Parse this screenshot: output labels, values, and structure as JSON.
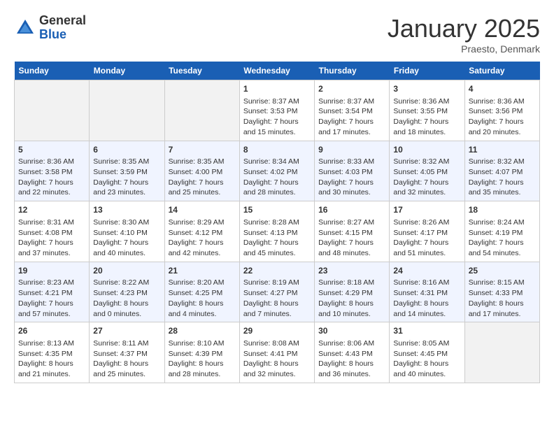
{
  "header": {
    "logo_general": "General",
    "logo_blue": "Blue",
    "month_title": "January 2025",
    "subtitle": "Praesto, Denmark"
  },
  "weekdays": [
    "Sunday",
    "Monday",
    "Tuesday",
    "Wednesday",
    "Thursday",
    "Friday",
    "Saturday"
  ],
  "weeks": [
    [
      {
        "day": "",
        "info": ""
      },
      {
        "day": "",
        "info": ""
      },
      {
        "day": "",
        "info": ""
      },
      {
        "day": "1",
        "info": "Sunrise: 8:37 AM\nSunset: 3:53 PM\nDaylight: 7 hours\nand 15 minutes."
      },
      {
        "day": "2",
        "info": "Sunrise: 8:37 AM\nSunset: 3:54 PM\nDaylight: 7 hours\nand 17 minutes."
      },
      {
        "day": "3",
        "info": "Sunrise: 8:36 AM\nSunset: 3:55 PM\nDaylight: 7 hours\nand 18 minutes."
      },
      {
        "day": "4",
        "info": "Sunrise: 8:36 AM\nSunset: 3:56 PM\nDaylight: 7 hours\nand 20 minutes."
      }
    ],
    [
      {
        "day": "5",
        "info": "Sunrise: 8:36 AM\nSunset: 3:58 PM\nDaylight: 7 hours\nand 22 minutes."
      },
      {
        "day": "6",
        "info": "Sunrise: 8:35 AM\nSunset: 3:59 PM\nDaylight: 7 hours\nand 23 minutes."
      },
      {
        "day": "7",
        "info": "Sunrise: 8:35 AM\nSunset: 4:00 PM\nDaylight: 7 hours\nand 25 minutes."
      },
      {
        "day": "8",
        "info": "Sunrise: 8:34 AM\nSunset: 4:02 PM\nDaylight: 7 hours\nand 28 minutes."
      },
      {
        "day": "9",
        "info": "Sunrise: 8:33 AM\nSunset: 4:03 PM\nDaylight: 7 hours\nand 30 minutes."
      },
      {
        "day": "10",
        "info": "Sunrise: 8:32 AM\nSunset: 4:05 PM\nDaylight: 7 hours\nand 32 minutes."
      },
      {
        "day": "11",
        "info": "Sunrise: 8:32 AM\nSunset: 4:07 PM\nDaylight: 7 hours\nand 35 minutes."
      }
    ],
    [
      {
        "day": "12",
        "info": "Sunrise: 8:31 AM\nSunset: 4:08 PM\nDaylight: 7 hours\nand 37 minutes."
      },
      {
        "day": "13",
        "info": "Sunrise: 8:30 AM\nSunset: 4:10 PM\nDaylight: 7 hours\nand 40 minutes."
      },
      {
        "day": "14",
        "info": "Sunrise: 8:29 AM\nSunset: 4:12 PM\nDaylight: 7 hours\nand 42 minutes."
      },
      {
        "day": "15",
        "info": "Sunrise: 8:28 AM\nSunset: 4:13 PM\nDaylight: 7 hours\nand 45 minutes."
      },
      {
        "day": "16",
        "info": "Sunrise: 8:27 AM\nSunset: 4:15 PM\nDaylight: 7 hours\nand 48 minutes."
      },
      {
        "day": "17",
        "info": "Sunrise: 8:26 AM\nSunset: 4:17 PM\nDaylight: 7 hours\nand 51 minutes."
      },
      {
        "day": "18",
        "info": "Sunrise: 8:24 AM\nSunset: 4:19 PM\nDaylight: 7 hours\nand 54 minutes."
      }
    ],
    [
      {
        "day": "19",
        "info": "Sunrise: 8:23 AM\nSunset: 4:21 PM\nDaylight: 7 hours\nand 57 minutes."
      },
      {
        "day": "20",
        "info": "Sunrise: 8:22 AM\nSunset: 4:23 PM\nDaylight: 8 hours\nand 0 minutes."
      },
      {
        "day": "21",
        "info": "Sunrise: 8:20 AM\nSunset: 4:25 PM\nDaylight: 8 hours\nand 4 minutes."
      },
      {
        "day": "22",
        "info": "Sunrise: 8:19 AM\nSunset: 4:27 PM\nDaylight: 8 hours\nand 7 minutes."
      },
      {
        "day": "23",
        "info": "Sunrise: 8:18 AM\nSunset: 4:29 PM\nDaylight: 8 hours\nand 10 minutes."
      },
      {
        "day": "24",
        "info": "Sunrise: 8:16 AM\nSunset: 4:31 PM\nDaylight: 8 hours\nand 14 minutes."
      },
      {
        "day": "25",
        "info": "Sunrise: 8:15 AM\nSunset: 4:33 PM\nDaylight: 8 hours\nand 17 minutes."
      }
    ],
    [
      {
        "day": "26",
        "info": "Sunrise: 8:13 AM\nSunset: 4:35 PM\nDaylight: 8 hours\nand 21 minutes."
      },
      {
        "day": "27",
        "info": "Sunrise: 8:11 AM\nSunset: 4:37 PM\nDaylight: 8 hours\nand 25 minutes."
      },
      {
        "day": "28",
        "info": "Sunrise: 8:10 AM\nSunset: 4:39 PM\nDaylight: 8 hours\nand 28 minutes."
      },
      {
        "day": "29",
        "info": "Sunrise: 8:08 AM\nSunset: 4:41 PM\nDaylight: 8 hours\nand 32 minutes."
      },
      {
        "day": "30",
        "info": "Sunrise: 8:06 AM\nSunset: 4:43 PM\nDaylight: 8 hours\nand 36 minutes."
      },
      {
        "day": "31",
        "info": "Sunrise: 8:05 AM\nSunset: 4:45 PM\nDaylight: 8 hours\nand 40 minutes."
      },
      {
        "day": "",
        "info": ""
      }
    ]
  ]
}
